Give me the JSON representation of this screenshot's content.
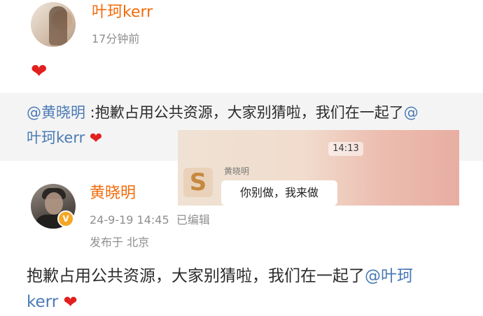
{
  "post_top": {
    "author": "叶珂kerr",
    "time": "17分钟前",
    "content_emoji": "❤"
  },
  "quote": {
    "mention_self": "@黄晓明",
    "text": " :抱歉占用公共资源，大家别猜啦，我们在一起了",
    "mention_target_prefix": "@",
    "mention_target_name": "叶珂kerr",
    "emoji": "❤"
  },
  "chat_screenshot": {
    "time": "14:13",
    "sender": "黄晓明",
    "avatar_glyph": "S",
    "message": "你别做，我来做"
  },
  "post_main": {
    "author": "黄晓明",
    "time": "24-9-19 14:45",
    "edited": "已编辑",
    "location": "发布于 北京",
    "verify_mark": "V",
    "text": "抱歉占用公共资源，大家别猜啦，我们在一起了",
    "mention_a": "@叶珂",
    "mention_b": "kerr",
    "emoji": "❤"
  },
  "colors": {
    "name": "#f36b0b",
    "mention": "#4a7ab5",
    "meta": "#8f8f8f",
    "heart": "#e1201f",
    "verify": "#f5a623"
  }
}
